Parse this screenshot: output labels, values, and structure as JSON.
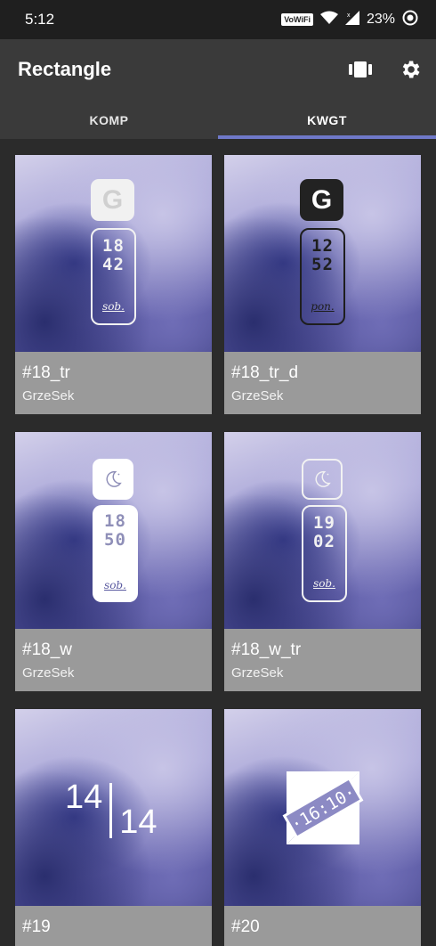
{
  "status": {
    "time": "5:12",
    "vowifi": "VoWiFi",
    "battery": "23%"
  },
  "appbar": {
    "title": "Rectangle"
  },
  "tabs": [
    {
      "label": "KOMP"
    },
    {
      "label": "KWGT"
    }
  ],
  "active_tab": "KWGT",
  "widgets": [
    {
      "name": "#18_tr",
      "author": "GrzeSek",
      "hour": "18",
      "minute": "42",
      "day": "sob.",
      "g_icon": "G"
    },
    {
      "name": "#18_tr_d",
      "author": "GrzeSek",
      "hour": "12",
      "minute": "52",
      "day": "pon.",
      "g_icon": "G"
    },
    {
      "name": "#18_w",
      "author": "GrzeSek",
      "hour": "18",
      "minute": "50",
      "day": "sob."
    },
    {
      "name": "#18_w_tr",
      "author": "GrzeSek",
      "hour": "19",
      "minute": "02",
      "day": "sob."
    },
    {
      "name": "#19",
      "hour": "14",
      "minute": "14"
    },
    {
      "name": "#20",
      "time": "·16:10·"
    }
  ],
  "colors": {
    "accent": "#6f78c8",
    "appbar": "#3a3a3a",
    "card_footer": "#9a9a9a"
  }
}
